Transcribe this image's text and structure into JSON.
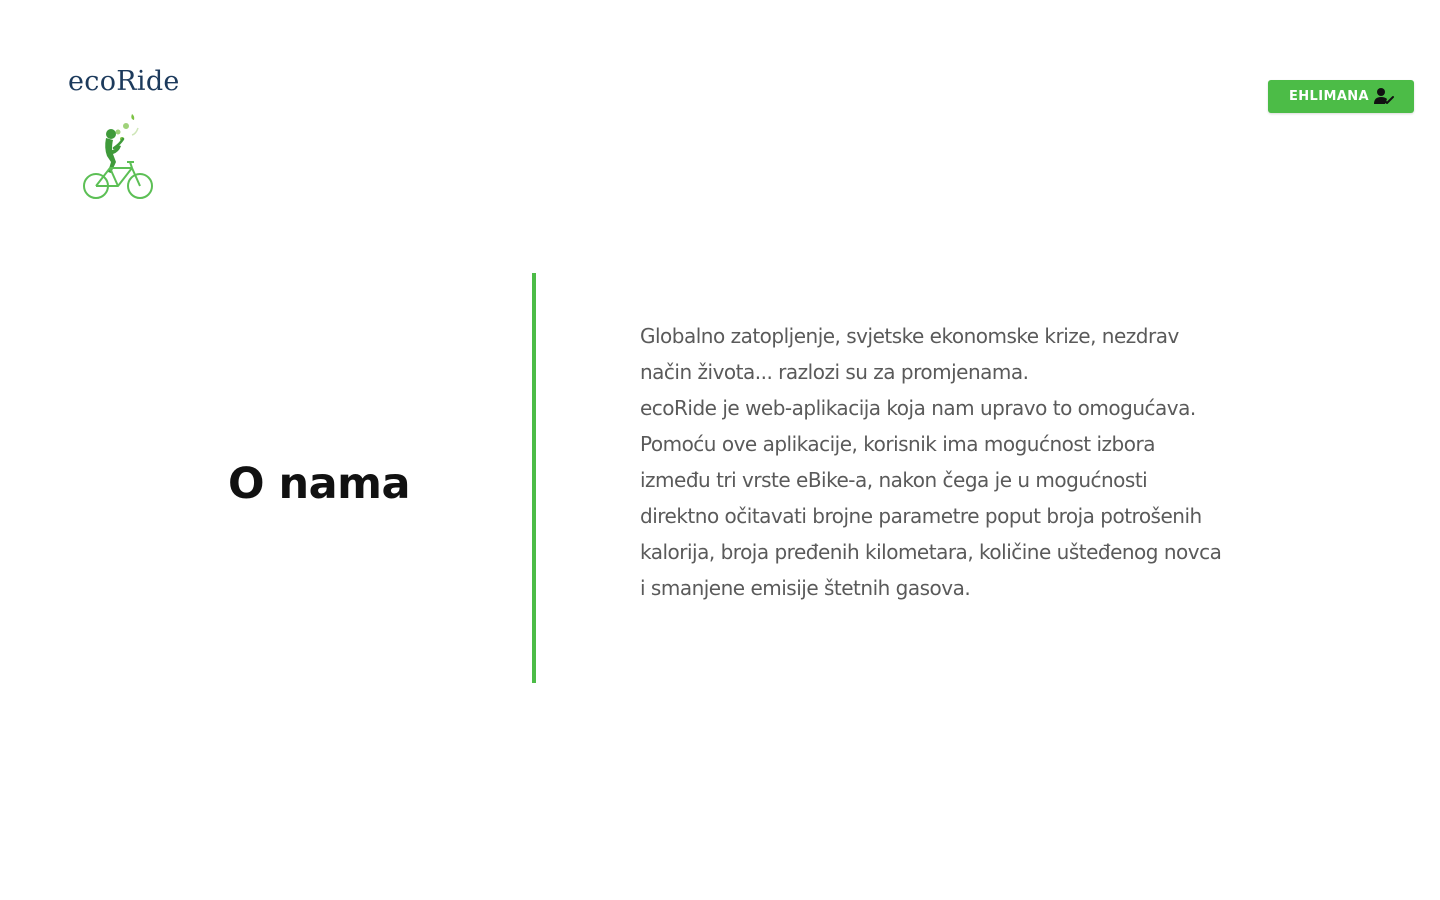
{
  "brand": {
    "name": "ecoRide"
  },
  "header": {
    "user_button_label": "EHLIMANA",
    "user_icon": "user-check-icon"
  },
  "main": {
    "title": "O nama",
    "paragraph_lines": [
      "Globalno zatopljenje, svjetske ekonomske krize, nezdrav",
      "način života... razlozi su za promjenama.",
      "ecoRide je web-aplikacija koja nam upravo to omogućava.",
      "Pomoću ove aplikacije, korisnik ima mogućnost izbora",
      "između tri vrste eBike-a, nakon čega je u mogućnosti",
      "direktno očitavati brojne parametre poput broja potrošenih",
      "kalorija, broja pređenih kilometara, količine ušteđenog novca",
      "i smanjene emisije štetnih gasova."
    ]
  },
  "colors": {
    "accent": "#4cbc47",
    "brand_text": "#1c3a5c",
    "body_text": "#5a5a5a",
    "title_text": "#111111"
  }
}
